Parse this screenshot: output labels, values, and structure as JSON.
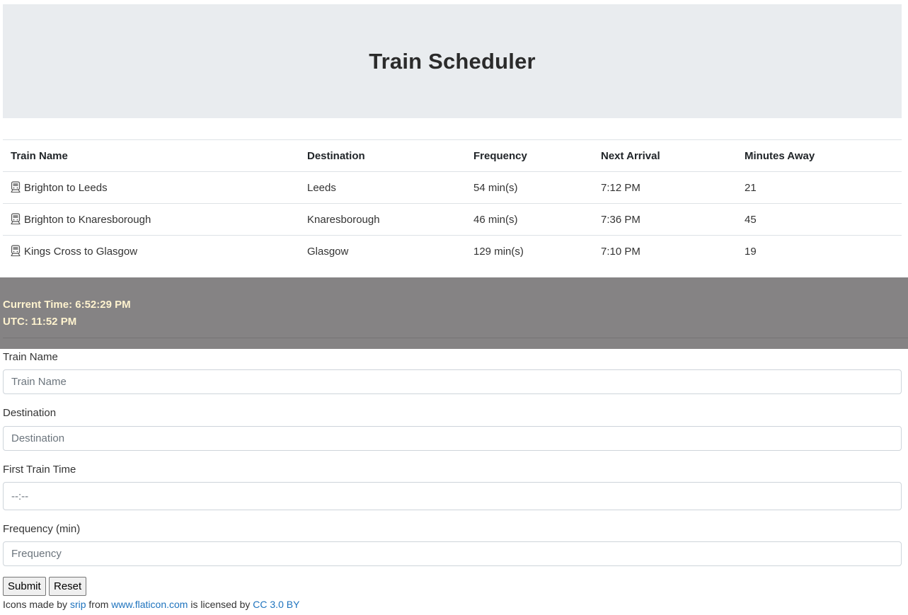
{
  "header": {
    "title": "Train Scheduler"
  },
  "table": {
    "columns": [
      "Train Name",
      "Destination",
      "Frequency",
      "Next Arrival",
      "Minutes Away"
    ],
    "rows": [
      {
        "icon": "train-icon",
        "name": "Brighton to Leeds",
        "destination": "Leeds",
        "frequency": "54 min(s)",
        "next_arrival": "7:12 PM",
        "minutes_away": "21"
      },
      {
        "icon": "train-icon",
        "name": "Brighton to Knaresborough",
        "destination": "Knaresborough",
        "frequency": "46 min(s)",
        "next_arrival": "7:36 PM",
        "minutes_away": "45"
      },
      {
        "icon": "train-icon",
        "name": "Kings Cross to Glasgow",
        "destination": "Glasgow",
        "frequency": "129 min(s)",
        "next_arrival": "7:10 PM",
        "minutes_away": "19"
      }
    ]
  },
  "clock": {
    "current_time": "Current Time: 6:52:29 PM",
    "utc": "UTC: 11:52 PM"
  },
  "form": {
    "train_name": {
      "label": "Train Name",
      "placeholder": "Train Name",
      "value": ""
    },
    "destination": {
      "label": "Destination",
      "placeholder": "Destination",
      "value": ""
    },
    "first_train_time": {
      "label": "First Train Time",
      "placeholder": "--:--",
      "value": ""
    },
    "frequency": {
      "label": "Frequency (min)",
      "placeholder": "Frequency",
      "value": ""
    },
    "submit_label": "Submit",
    "reset_label": "Reset"
  },
  "credit": {
    "prefix": "Icons made by",
    "author": "srip",
    "from": "from",
    "site": "www.flaticon.com",
    "licensed": "is licensed by",
    "license": "CC 3.0 BY"
  },
  "colors": {
    "jumbotron_bg": "#e9ecef",
    "time_bar_bg": "#858384",
    "time_bar_text": "#fff3cf",
    "link": "#1e73be"
  }
}
